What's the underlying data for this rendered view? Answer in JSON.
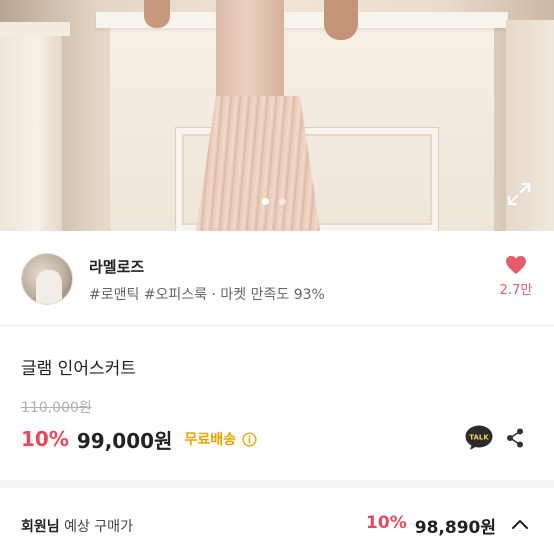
{
  "hero": {
    "slide_count": 2,
    "active_slide": 1,
    "expand_icon": "expand-icon"
  },
  "shop": {
    "name": "라멜로즈",
    "tags": "#로맨틱 #오피스룩 · 마켓 만족도 93%",
    "like_count": "2.7만",
    "heart_color": "#e55c6b"
  },
  "product": {
    "title": "글램 인어스커트",
    "original_price": "110,000원",
    "discount": "10%",
    "price": "99,000원",
    "shipping": "무료배송",
    "discount_color": "#e9485c",
    "shipping_color": "#e8a400"
  },
  "actions": {
    "talk_label": "TALK",
    "talk_icon": "kakaotalk-icon",
    "share_icon": "share-icon"
  },
  "member": {
    "label_bold": "회원님",
    "label_rest": "예상 구매가",
    "discount": "10%",
    "price": "98,890원"
  }
}
